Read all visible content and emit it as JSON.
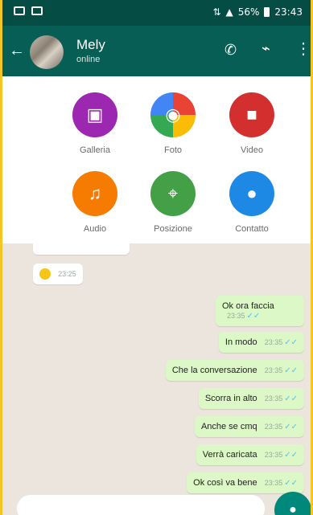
{
  "status_bar": {
    "signal": "4G",
    "battery": "56%",
    "time": "23:43"
  },
  "header": {
    "back_icon": "back-arrow-icon",
    "contact_name": "Mely",
    "contact_status": "online",
    "call_icon": "phone-icon",
    "attach_icon": "paperclip-icon",
    "menu_icon": "more-vert-icon"
  },
  "attachments": [
    {
      "label": "Galleria",
      "icon": "image-icon",
      "color": "#9c27b0"
    },
    {
      "label": "Foto",
      "icon": "camera-icon",
      "color": "#e84335"
    },
    {
      "label": "Video",
      "icon": "video-icon",
      "color": "#d32f2f"
    },
    {
      "label": "Audio",
      "icon": "headphones-icon",
      "color": "#f57c00"
    },
    {
      "label": "Posizione",
      "icon": "map-pin-icon",
      "color": "#43a047"
    },
    {
      "label": "Contatto",
      "icon": "person-icon",
      "color": "#1e88e5"
    }
  ],
  "messages_in": [
    {
      "text": "",
      "time": "23:25"
    }
  ],
  "messages_out": [
    {
      "text": "Ok ora faccia",
      "time": "23:35"
    },
    {
      "text": "In modo",
      "time": "23:35"
    },
    {
      "text": "Che la conversazione",
      "time": "23:35"
    },
    {
      "text": "Scorra in alto",
      "time": "23:35"
    },
    {
      "text": "Anche se cmq",
      "time": "23:35"
    },
    {
      "text": "Verrà caricata",
      "time": "23:35"
    },
    {
      "text": "Ok così va bene",
      "time": "23:35"
    }
  ],
  "mic_icon": "mic-icon",
  "colors": {
    "header_bg": "#075e54",
    "status_bg": "#054d44",
    "chat_bg": "#ece5dd",
    "outgoing_bubble": "#dcf8c6",
    "accent": "#00897b"
  }
}
